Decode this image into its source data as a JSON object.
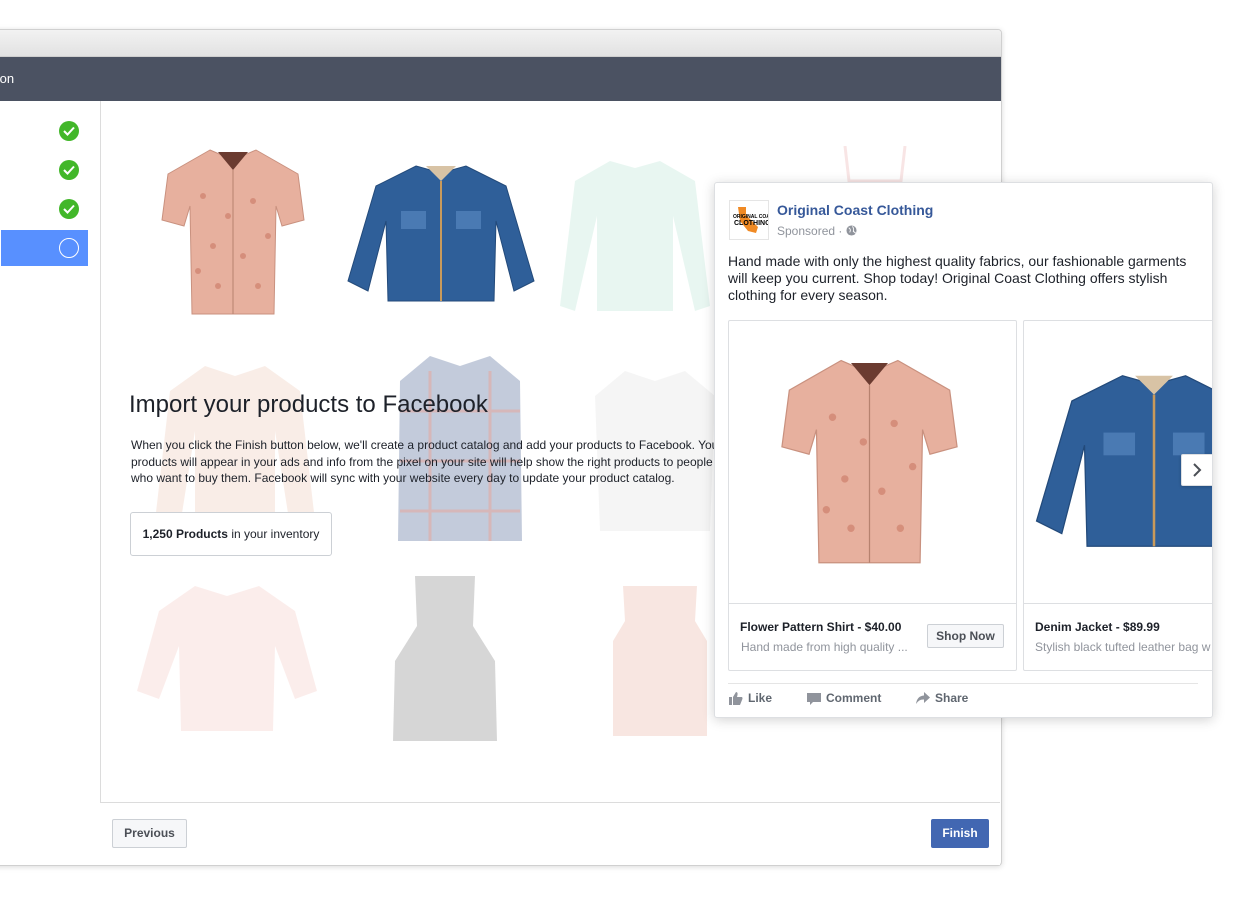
{
  "window": {
    "header_title": "nsion"
  },
  "sidebar": {
    "steps": [
      {
        "state": "complete",
        "icon": "check-circle-icon"
      },
      {
        "state": "complete",
        "icon": "check-circle-icon"
      },
      {
        "state": "complete",
        "icon": "check-circle-icon"
      },
      {
        "state": "active",
        "icon": "empty-circle-icon"
      }
    ]
  },
  "main": {
    "heading": "Import your products to Facebook",
    "description": "When you click the Finish button below, we'll create a product catalog and add your products to Facebook. Your products will appear in your ads and info from the pixel on your site will help show the right products to people who want to buy them. Facebook will sync with your website every day to update your product catalog.",
    "inventory": {
      "count": "1,250 Products",
      "suffix": " in your inventory"
    }
  },
  "footer": {
    "previous_label": "Previous",
    "finish_label": "Finish"
  },
  "ad": {
    "page_name": "Original Coast Clothing",
    "logo_text": "ORIGINAL COAST CLOTHING",
    "sponsored": "Sponsored",
    "text": "Hand made with only the highest quality fabrics, our fashionable garments will keep you current. Shop today! Original Coast Clothing offers stylish clothing for every season.",
    "cards": [
      {
        "title": "Flower Pattern Shirt - $40.00",
        "subtitle": "Hand made from high quality ...",
        "cta": "Shop Now"
      },
      {
        "title": "Denim Jacket - $89.99",
        "subtitle": "Stylish black tufted leather bag w"
      }
    ],
    "actions": {
      "like": "Like",
      "comment": "Comment",
      "share": "Share"
    }
  },
  "colors": {
    "header_bg": "#4b5262",
    "active_step": "#5890ff",
    "check_green": "#42b72a",
    "finish_blue": "#4267b2",
    "page_name_blue": "#365899"
  }
}
